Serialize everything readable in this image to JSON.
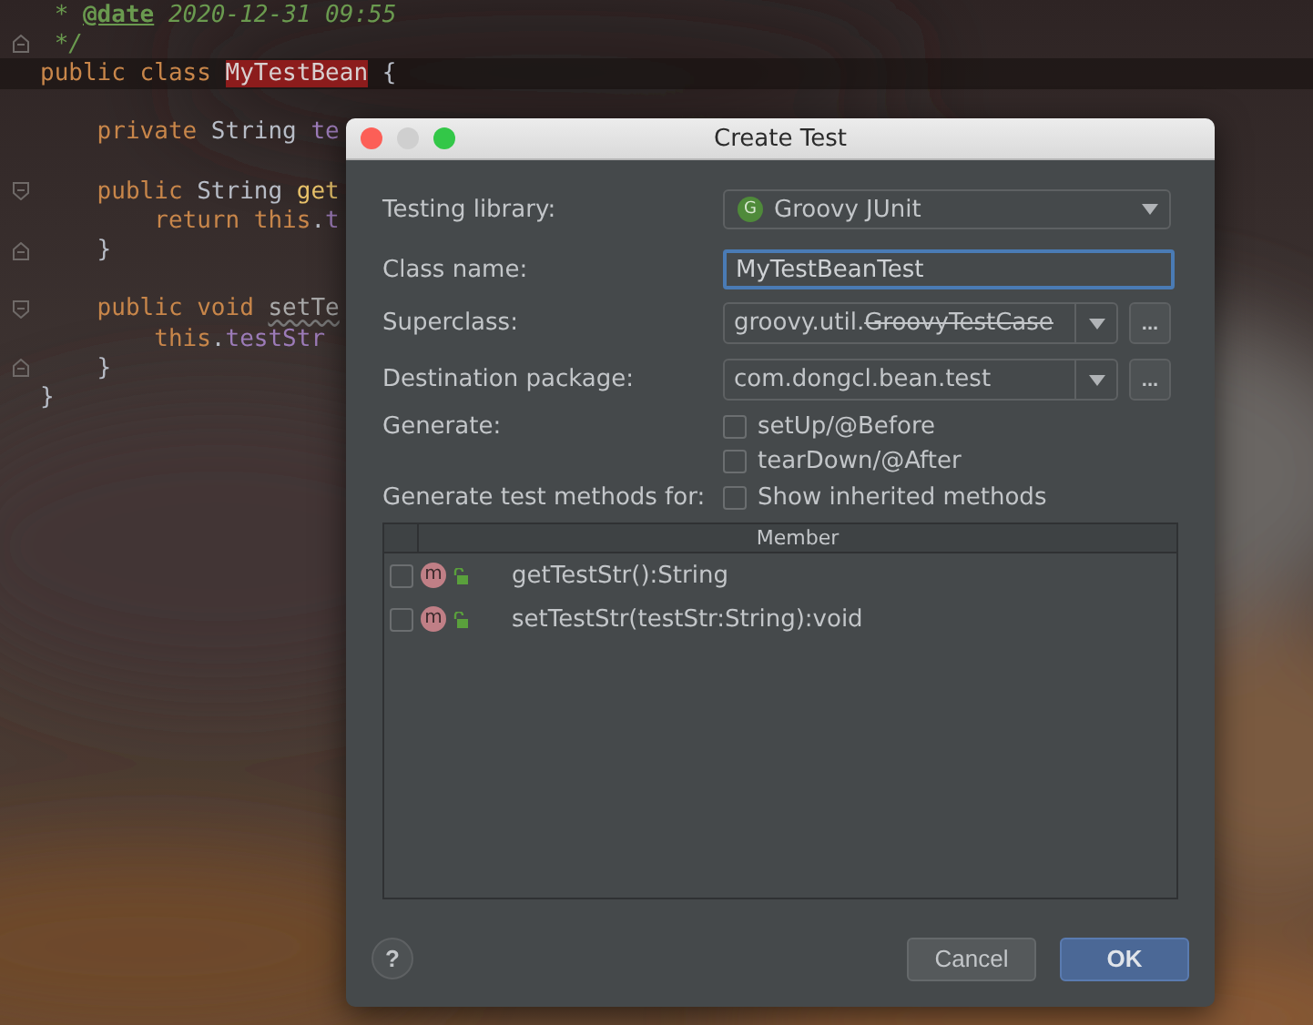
{
  "editor": {
    "lines": [
      {
        "kind": "code",
        "current": false,
        "tokens": [
          {
            "text": " * ",
            "kind": "comment"
          },
          {
            "text": "@date",
            "kind": "doc-tag"
          },
          {
            "text": " 2020-12-31 09:55",
            "kind": "comment"
          }
        ]
      },
      {
        "kind": "fold-end",
        "current": false,
        "tokens": [
          {
            "text": " */",
            "kind": "comment"
          }
        ]
      },
      {
        "kind": "code",
        "current": true,
        "tokens": [
          {
            "text": "public class ",
            "kind": "keyword"
          },
          {
            "text": "MyTestBean",
            "kind": "highlighted"
          },
          {
            "text": " {",
            "kind": "plain"
          }
        ]
      },
      {
        "kind": "blank",
        "current": false
      },
      {
        "kind": "code",
        "current": false,
        "tokens": [
          {
            "text": "    private ",
            "kind": "keyword"
          },
          {
            "text": "String ",
            "kind": "plain"
          },
          {
            "text": "te",
            "kind": "field"
          }
        ]
      },
      {
        "kind": "blank",
        "current": false
      },
      {
        "kind": "fold-start",
        "current": false,
        "tokens": [
          {
            "text": "    public ",
            "kind": "keyword"
          },
          {
            "text": "String ",
            "kind": "plain"
          },
          {
            "text": "get",
            "kind": "method"
          }
        ]
      },
      {
        "kind": "code",
        "current": false,
        "tokens": [
          {
            "text": "        return this",
            "kind": "keyword"
          },
          {
            "text": ".",
            "kind": "plain"
          },
          {
            "text": "t",
            "kind": "field"
          }
        ]
      },
      {
        "kind": "fold-end",
        "current": false,
        "tokens": [
          {
            "text": "    }",
            "kind": "plain"
          }
        ]
      },
      {
        "kind": "blank",
        "current": false
      },
      {
        "kind": "fold-start",
        "current": false,
        "tokens": [
          {
            "text": "    public void ",
            "kind": "keyword"
          },
          {
            "text": "setTe",
            "kind": "unused"
          }
        ]
      },
      {
        "kind": "code",
        "current": false,
        "tokens": [
          {
            "text": "        this",
            "kind": "keyword"
          },
          {
            "text": ".",
            "kind": "plain"
          },
          {
            "text": "testStr",
            "kind": "field"
          }
        ]
      },
      {
        "kind": "fold-end",
        "current": false,
        "tokens": [
          {
            "text": "    }",
            "kind": "plain"
          }
        ]
      },
      {
        "kind": "code",
        "current": false,
        "tokens": [
          {
            "text": "}",
            "kind": "plain"
          }
        ]
      }
    ]
  },
  "dialog": {
    "title": "Create Test",
    "testing_library": {
      "label": "Testing library:",
      "value": "Groovy JUnit",
      "icon_letter": "G"
    },
    "class_name": {
      "label": "Class name:",
      "value": "MyTestBeanTest",
      "focused": true
    },
    "superclass": {
      "label": "Superclass:",
      "value_parts": [
        {
          "text": "groovy.util.",
          "deprecated": false
        },
        {
          "text": "GroovyTestCase",
          "deprecated": true
        }
      ],
      "browse": "..."
    },
    "destination_package": {
      "label": "Destination package:",
      "value_parts": [
        {
          "text": "com.dongcl.bean.test",
          "deprecated": false
        }
      ],
      "browse": "..."
    },
    "generate": {
      "label": "Generate:",
      "options": [
        {
          "label": "setUp/@Before",
          "checked": false
        },
        {
          "label": "tearDown/@After",
          "checked": false
        }
      ]
    },
    "methods_for": {
      "label": "Generate test methods for:",
      "option": {
        "label": "Show inherited methods",
        "checked": false
      }
    },
    "table": {
      "columns": [
        "Member"
      ],
      "rows": [
        {
          "icon_letter": "m",
          "name": "getTestStr():String",
          "checked": false
        },
        {
          "icon_letter": "m",
          "name": "setTestStr(testStr:String):void",
          "checked": false
        }
      ]
    },
    "help": "?",
    "buttons": [
      {
        "label": "Cancel",
        "default": false
      },
      {
        "label": "OK",
        "default": true
      }
    ]
  }
}
